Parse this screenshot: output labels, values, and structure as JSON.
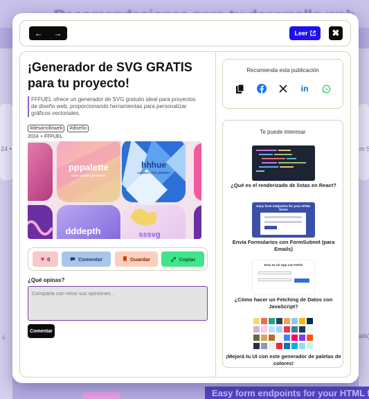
{
  "background": {
    "title": "Recomendaciones para tu desarrollo web",
    "side_left_1": "24 • ",
    "side_left_2": "¿",
    "side_right_1": "m Sa",
    "side_right_2": "ails)",
    "bottom_link": "Easy form endpoints for your HTML forms"
  },
  "modal": {
    "nav_back": "←",
    "nav_forward": "→",
    "read_label": "Leer",
    "close_label": "✖",
    "article": {
      "title": "¡Generador de SVG GRATIS para tu proyecto!",
      "description": "FFFUEL ofrece un generador de SVG gratuito ideal para proyectos de diseño web, proporcionando herramientas para personalizar gráficos vectoriales.",
      "tags": [
        "#desarrolloweb",
        "#diseño"
      ],
      "year": "2024",
      "separator": "•",
      "source": "FFFUEL",
      "hero_texts": [
        "pppalette",
        "color palette generator",
        "hhhue",
        "curated color palettes",
        "dddepth",
        "sssvg"
      ]
    },
    "actions": {
      "likes": "0",
      "comment": "Comentar",
      "save": "Guardar",
      "copy": "Copiar"
    },
    "comments": {
      "question": "¿Qué opinas?",
      "placeholder": "Comparta con otros sus opiniones...",
      "submit": "Comentar"
    },
    "share": {
      "heading": "Recomienda esta publicación",
      "icons": [
        "copy-icon",
        "facebook-icon",
        "x-icon",
        "linkedin-icon",
        "whatsapp-icon"
      ]
    },
    "recommendations": {
      "heading": "Te puede interesar",
      "items": [
        {
          "title": "¿Qué es el renderizado de listas en React?"
        },
        {
          "title": "Envía Formularios con FormSubmit (para Emails)",
          "thumb_text": "Easy form endpoints for your HTML forms"
        },
        {
          "title": "¿Cómo hacer un Fetching de Datos con JavaScript?",
          "thumb_text": "Esta es mi App con Fetch"
        },
        {
          "title": "¡Mejorá tu UI con este generador de paletas de colores!"
        }
      ]
    }
  },
  "colors": {
    "accent_blue": "#1f10ee",
    "like_bg": "#f7c8cc",
    "comment_bg": "#a9c6e8",
    "save_bg": "#fbd0bb",
    "copy_bg": "#3ee58a"
  }
}
